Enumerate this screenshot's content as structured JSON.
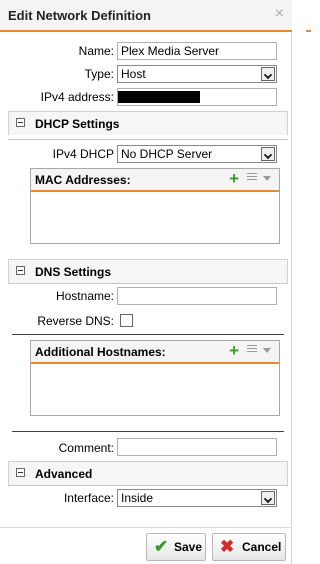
{
  "dialog": {
    "title": "Edit Network Definition",
    "close_icon": "×"
  },
  "fields": {
    "name_label": "Name:",
    "name_value": "Plex Media Server",
    "type_label": "Type:",
    "type_value": "Host",
    "ipv4_label": "IPv4 address:"
  },
  "dhcp": {
    "title": "DHCP Settings",
    "ipv4_dhcp_label": "IPv4 DHCP",
    "ipv4_dhcp_value": "No DHCP Server",
    "mac_title": "MAC Addresses:"
  },
  "dns": {
    "title": "DNS Settings",
    "hostname_label": "Hostname:",
    "reverse_dns_label": "Reverse DNS:",
    "additional_title": "Additional Hostnames:"
  },
  "comment": {
    "label": "Comment:"
  },
  "advanced": {
    "title": "Advanced",
    "interface_label": "Interface:",
    "interface_value": "Inside"
  },
  "buttons": {
    "save": "Save",
    "cancel": "Cancel",
    "plus": "+"
  },
  "colors": {
    "accent": "#e8892b",
    "save_icon": "#3a9a2a",
    "cancel_icon": "#d42a2a"
  }
}
